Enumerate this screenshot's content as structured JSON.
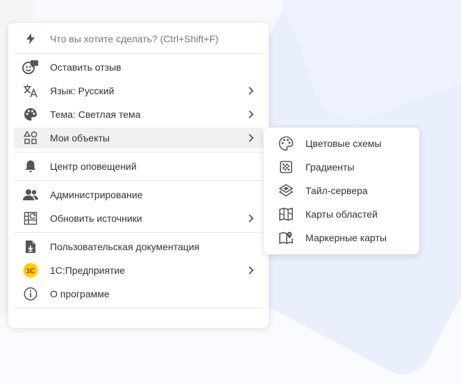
{
  "search": {
    "placeholder": "Что вы хотите сделать? (Ctrl+Shift+F)",
    "icon": "lightning-icon"
  },
  "menu": {
    "feedback": "Оставить отзыв",
    "language": "Язык: Русский",
    "theme": "Тема: Светлая тема",
    "my_objects": "Мои объекты",
    "notifications": "Центр оповещений",
    "administration": "Администрирование",
    "refresh_sources": "Обновить источники",
    "user_docs": "Пользовательская документация",
    "onec": "1С:Предприятие",
    "onec_logo": "1С",
    "about": "О программе"
  },
  "submenu": {
    "color_schemes": "Цветовые схемы",
    "gradients": "Градиенты",
    "tile_servers": "Тайл-сервера",
    "area_maps": "Карты областей",
    "marker_maps": "Маркерные карты"
  },
  "colors": {
    "icon": "#555555",
    "text": "#333333",
    "active_bg": "#f0f0f0",
    "onec_yellow": "#ffd100",
    "onec_red": "#d7141a"
  }
}
